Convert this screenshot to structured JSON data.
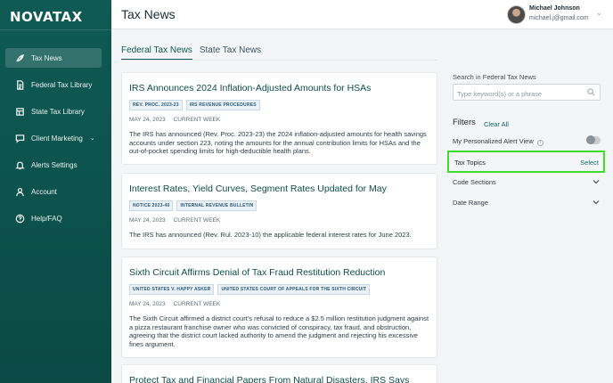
{
  "app": {
    "logo": "NOVATAX",
    "page_title": "Tax News"
  },
  "user": {
    "name": "Michael Johnson",
    "email": "michael.j@gmail.com"
  },
  "sidebar": {
    "items": [
      {
        "label": "Tax News",
        "icon": "rocket-icon",
        "active": true
      },
      {
        "label": "Federal Tax Library",
        "icon": "document-icon"
      },
      {
        "label": "State Tax Library",
        "icon": "library-icon"
      },
      {
        "label": "Client Marketing",
        "icon": "chat-icon",
        "has_chevron": true
      },
      {
        "label": "Alerts Settings",
        "icon": "bell-icon"
      },
      {
        "label": "Account",
        "icon": "user-icon"
      },
      {
        "label": "Help/FAQ",
        "icon": "help-icon"
      }
    ]
  },
  "tabs": [
    {
      "label": "Federal Tax News",
      "active": true
    },
    {
      "label": "State Tax News"
    }
  ],
  "articles": [
    {
      "title": "IRS Announces 2024 Inflation-Adjusted Amounts for HSAs",
      "tags": [
        "REV. PROC. 2023-23",
        "IRS REVENUE PROCEDURES"
      ],
      "date": "MAY 24, 2023",
      "period": "CURRENT WEEK",
      "excerpt": "The IRS has announced (Rev. Proc. 2023-23) the 2024 inflation-adjusted amounts for health savings accounts under section 223, noting the amounts for the annual contribution limits for HSAs and the out-of-pocket spending limits for high-deductible health plans."
    },
    {
      "title": "Interest Rates, Yield Curves, Segment Rates Updated for May",
      "tags": [
        "NOTICE 2023-40",
        "INTERNAL REVENUE BULLETIN"
      ],
      "date": "MAY 24, 2023",
      "period": "CURRENT WEEK",
      "excerpt": "The IRS has announced (Rev. Rul. 2023-10) the applicable federal interest rates for June 2023."
    },
    {
      "title": "Sixth Circuit Affirms Denial of Tax Fraud Restitution Reduction",
      "tags": [
        "UNITED STATES V. HAPPY ASKER",
        "UNITED STATES COURT OF APPEALS FOR THE SIXTH CIRCUIT"
      ],
      "date": "MAY 24, 2023",
      "period": "CURRENT WEEK",
      "excerpt": "The Sixth Circuit affirmed a district court's refusal to reduce a $2.5 million restitution judgment against a pizza restaurant franchise owner who was convicted of conspiracy, tax fraud, and obstruction, agreeing that the district court lacked authority to amend the judgment and rejecting his excessive fines argument."
    },
    {
      "title": "Protect Tax and Financial Papers From Natural Disasters, IRS Says"
    }
  ],
  "search": {
    "label": "Search in Federal Tax News",
    "placeholder": "Type keyword(s) or a phrase"
  },
  "filters": {
    "title": "Filters",
    "clear_all": "Clear All",
    "alert_view_label": "My Personalized Alert View",
    "alert_view_enabled": false,
    "tax_topics_label": "Tax Topics",
    "tax_topics_action": "Select",
    "code_sections_label": "Code Sections",
    "date_range_label": "Date Range"
  },
  "colors": {
    "sidebar": "#0f5a54",
    "accent": "#0e6a63",
    "highlight": "#3edc2c"
  }
}
